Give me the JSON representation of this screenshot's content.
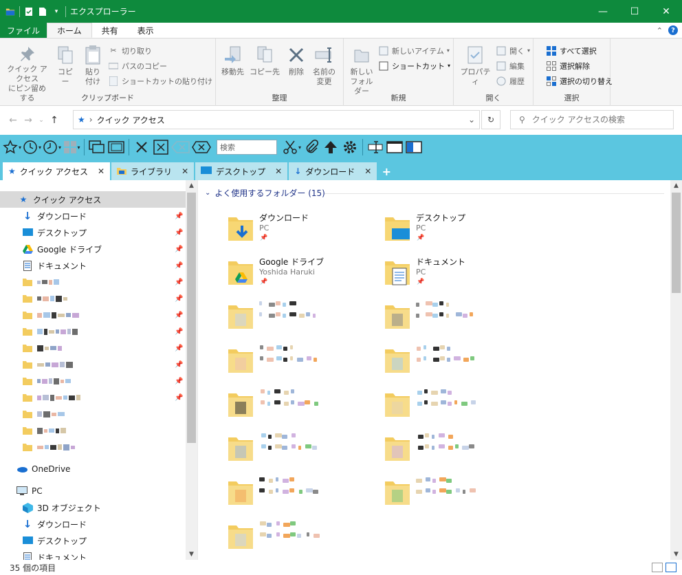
{
  "window": {
    "title": "エクスプローラー",
    "minimize": "—",
    "maximize": "☐",
    "close": "✕"
  },
  "ribbon_tabs": [
    "ファイル",
    "ホーム",
    "共有",
    "表示"
  ],
  "ribbon": {
    "clipboard": {
      "label": "クリップボード",
      "pin": [
        "クイック アクセス",
        "にピン留めする"
      ],
      "copy": "コピー",
      "paste": "貼り付け",
      "cut": "切り取り",
      "copy_path": "パスのコピー",
      "paste_shortcut": "ショートカットの貼り付け"
    },
    "organize": {
      "label": "整理",
      "move_to": "移動先",
      "copy_to": "コピー先",
      "delete": "削除",
      "rename": [
        "名前の",
        "変更"
      ]
    },
    "new": {
      "label": "新規",
      "new_folder": [
        "新しい",
        "フォルダー"
      ],
      "new_item": "新しいアイテム",
      "shortcut": "ショートカット"
    },
    "open": {
      "label": "開く",
      "properties": "プロパティ",
      "open": "開く",
      "edit": "編集",
      "history": "履歴"
    },
    "select": {
      "label": "選択",
      "select_all": "すべて選択",
      "select_none": "選択解除",
      "invert": "選択の切り替え"
    }
  },
  "address": {
    "path": "クイック アクセス",
    "search_placeholder": "クイック アクセスの検索"
  },
  "toolbar": {
    "search_placeholder": "検索"
  },
  "doc_tabs": [
    {
      "label": "クイック アクセス"
    },
    {
      "label": "ライブラリ"
    },
    {
      "label": "デスクトップ"
    },
    {
      "label": "ダウンロード"
    }
  ],
  "nav": {
    "quick_access": "クイック アクセス",
    "items": [
      "ダウンロード",
      "デスクトップ",
      "Google ドライブ",
      "ドキュメント"
    ],
    "onedrive": "OneDrive",
    "pc": "PC",
    "pc_items": [
      "3D オブジェクト",
      "ダウンロード",
      "デスクトップ",
      "ドキュメント"
    ]
  },
  "content": {
    "group_title": "よく使用するフォルダー (15)",
    "tiles": [
      {
        "name": "ダウンロード",
        "sub": "PC"
      },
      {
        "name": "デスクトップ",
        "sub": "PC"
      },
      {
        "name": "Google ドライブ",
        "sub": "Yoshida Haruki"
      },
      {
        "name": "ドキュメント",
        "sub": "PC"
      }
    ]
  },
  "status": {
    "count": "35 個の項目"
  },
  "colors": {
    "titlebar": "#0e8a3d",
    "toolbar": "#5bc6e0",
    "folder": "#f3cc5f",
    "accent": "#1a6fd1"
  }
}
